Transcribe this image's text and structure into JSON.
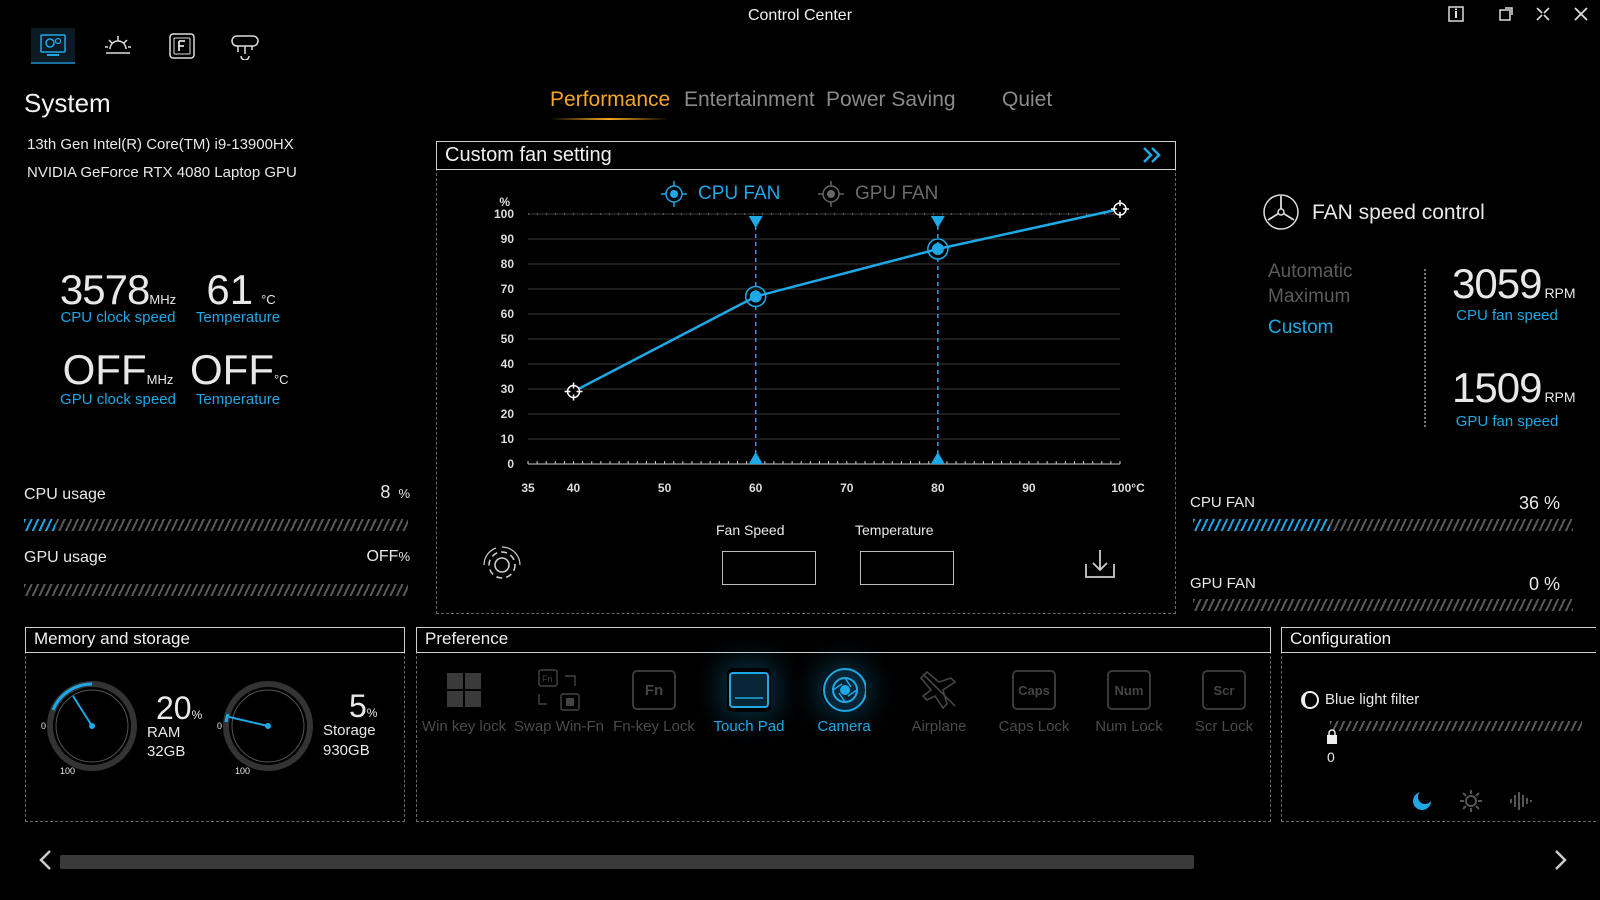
{
  "window": {
    "title": "Control Center"
  },
  "top_icons": [
    "gear-monitor-icon",
    "brightness-icon",
    "fn-key-icon",
    "network-icon"
  ],
  "system": {
    "heading": "System",
    "cpu_name": "13th Gen Intel(R) Core(TM) i9-13900HX",
    "gpu_name": "NVIDIA GeForce RTX 4080 Laptop GPU",
    "cpu_clock": {
      "value": "3578",
      "unit": "MHz",
      "label": "CPU clock speed"
    },
    "cpu_temp": {
      "value": "61",
      "unit": "°C",
      "label": "Temperature"
    },
    "gpu_clock": {
      "value": "OFF",
      "unit": "MHz",
      "label": "GPU clock speed"
    },
    "gpu_temp": {
      "value": "OFF",
      "unit": "°C",
      "label": "Temperature"
    },
    "cpu_usage": {
      "label": "CPU usage",
      "value": "8",
      "unit": "%",
      "fraction": 0.08
    },
    "gpu_usage": {
      "label": "GPU usage",
      "value": "OFF",
      "unit": "%",
      "fraction": 0
    }
  },
  "modes": {
    "items": [
      "Performance",
      "Entertainment",
      "Power Saving",
      "Quiet"
    ],
    "active": "Performance"
  },
  "fan_panel": {
    "title": "Custom fan setting",
    "tab_cpu": "CPU FAN",
    "tab_gpu": "GPU FAN",
    "fan_speed_label": "Fan Speed",
    "temperature_label": "Temperature",
    "fan_speed_value": "",
    "temperature_value": ""
  },
  "chart_data": {
    "type": "line",
    "title": "",
    "ylabel": "%",
    "xlabel": "",
    "x_ticks": [
      "35",
      "40",
      "50",
      "60",
      "70",
      "80",
      "90",
      "100°C"
    ],
    "y_ticks": [
      "0",
      "10",
      "20",
      "30",
      "40",
      "50",
      "60",
      "70",
      "80",
      "90",
      "100"
    ],
    "xlim": [
      35,
      100
    ],
    "ylim": [
      0,
      100
    ],
    "series": [
      {
        "name": "CPU FAN",
        "x": [
          40,
          60,
          80,
          100
        ],
        "y": [
          29,
          67,
          86,
          102
        ]
      }
    ],
    "markers_x": [
      60,
      80
    ],
    "grid": true
  },
  "fan_control": {
    "heading": "FAN speed control",
    "options": [
      "Automatic",
      "Maximum",
      "Custom"
    ],
    "selected": "Custom",
    "cpu_rpm": "3059",
    "gpu_rpm": "1509",
    "rpm_unit": "RPM",
    "cpu_rpm_label": "CPU fan speed",
    "gpu_rpm_label": "GPU fan speed",
    "cpu_fan": {
      "label": "CPU FAN",
      "value": "36 %",
      "fraction": 0.36
    },
    "gpu_fan": {
      "label": "GPU FAN",
      "value": "0 %",
      "fraction": 0
    }
  },
  "memory": {
    "title": "Memory and storage",
    "ram": {
      "percent": "20",
      "unit": "%",
      "label": "RAM",
      "size": "32GB",
      "fraction": 0.2
    },
    "storage": {
      "percent": "5",
      "unit": "%",
      "label": "Storage",
      "size": "930GB",
      "fraction": 0.05
    },
    "gauge_min": "0",
    "gauge_max": "100"
  },
  "preference": {
    "title": "Preference",
    "items": [
      {
        "label": "Win key lock",
        "on": false
      },
      {
        "label": "Swap Win-Fn",
        "on": false
      },
      {
        "label": "Fn-key Lock",
        "on": false
      },
      {
        "label": "Touch Pad",
        "on": true
      },
      {
        "label": "Camera",
        "on": true
      },
      {
        "label": "Airplane",
        "on": false
      },
      {
        "label": "Caps Lock",
        "on": false
      },
      {
        "label": "Num Lock",
        "on": false
      },
      {
        "label": "Scr Lock",
        "on": false
      }
    ],
    "fn_glyph": "Fn",
    "caps_glyph": "Caps",
    "num_glyph": "Num",
    "scr_glyph": "Scr"
  },
  "configuration": {
    "title": "Configuration",
    "blue_light_label": "Blue light filter",
    "blue_light_value": "0",
    "blue_light_fraction": 0
  },
  "colors": {
    "accent": "#1fa8e6",
    "active_mode": "#f5a623"
  }
}
